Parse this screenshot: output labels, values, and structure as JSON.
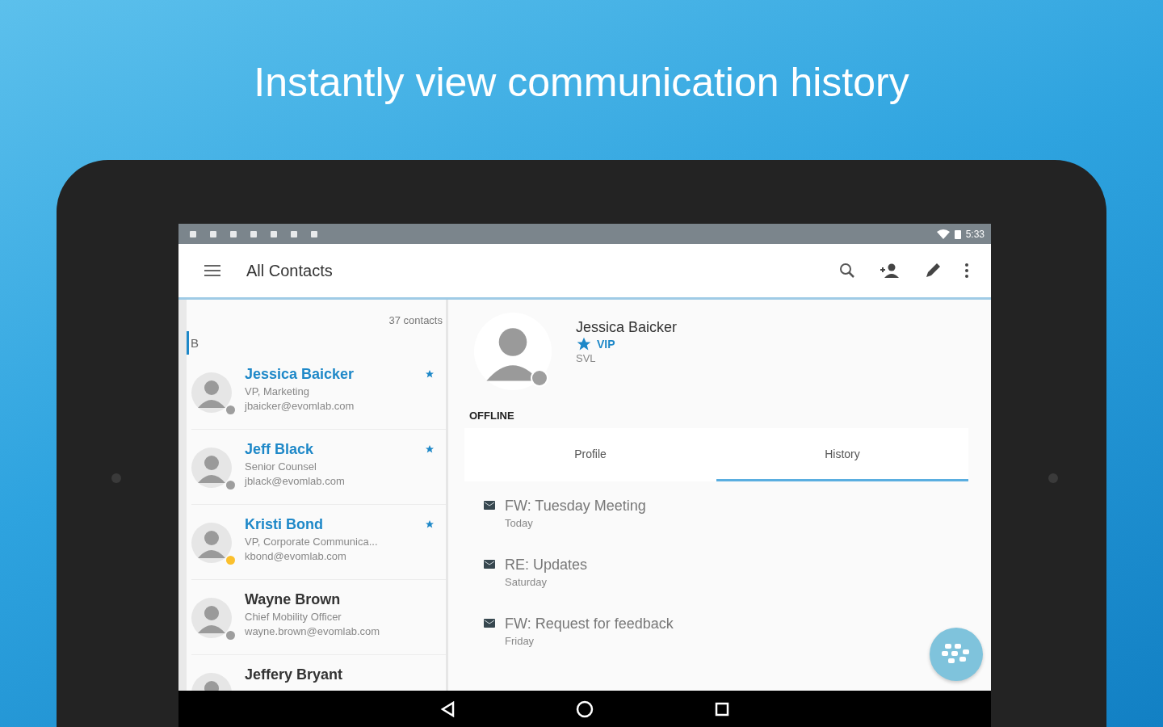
{
  "headline": "Instantly view communication history",
  "status_bar": {
    "time": "5:33"
  },
  "app_bar": {
    "title": "All Contacts"
  },
  "contact_list": {
    "count": "37 contacts",
    "section": "B",
    "contacts": [
      {
        "name": "Jessica Baicker",
        "title": "VP, Marketing",
        "email": "jbaicker@evomlab.com",
        "starred": true,
        "color": "#9e9e9e"
      },
      {
        "name": "Jeff Black",
        "title": "Senior Counsel",
        "email": "jblack@evomlab.com",
        "starred": true,
        "color": "#9e9e9e"
      },
      {
        "name": "Kristi Bond",
        "title": "VP, Corporate Communica...",
        "email": "kbond@evomlab.com",
        "starred": true,
        "color": "#fbc02d"
      },
      {
        "name": "Wayne Brown",
        "title": "Chief Mobility Officer",
        "email": "wayne.brown@evomlab.com",
        "starred": false,
        "color": "#9e9e9e"
      },
      {
        "name": "Jeffery Bryant",
        "starred": false
      }
    ]
  },
  "detail": {
    "name": "Jessica Baicker",
    "badge": "VIP",
    "location": "SVL",
    "online": false,
    "presence": "OFFLINE",
    "tabs": [
      {
        "label": "Profile",
        "selected": false
      },
      {
        "label": "History",
        "selected": true
      }
    ],
    "history": [
      {
        "subject": "FW: Tuesday Meeting",
        "day": "Today"
      },
      {
        "subject": "RE: Updates",
        "day": "Saturday"
      },
      {
        "subject": "FW: Request for feedback",
        "day": "Friday"
      }
    ]
  }
}
